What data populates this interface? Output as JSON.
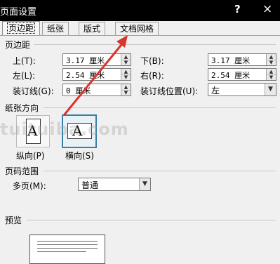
{
  "window": {
    "title": "页面设置",
    "help": "?",
    "close": "×"
  },
  "tabs": [
    {
      "label": "页边距",
      "active": true
    },
    {
      "label": "纸张",
      "active": false
    },
    {
      "label": "版式",
      "active": false
    },
    {
      "label": "文档网格",
      "active": false
    }
  ],
  "margins": {
    "section": "页边距",
    "top": {
      "label": "上(T):",
      "value": "3.17 厘米"
    },
    "bottom": {
      "label": "下(B):",
      "value": "3.17 厘米"
    },
    "left": {
      "label": "左(L):",
      "value": "2.54 厘米"
    },
    "right": {
      "label": "右(R):",
      "value": "2.54 厘米"
    },
    "gutter": {
      "label": "装订线(G):",
      "value": "0 厘米"
    },
    "gutter_position": {
      "label": "装订线位置(U):",
      "value": "左"
    }
  },
  "orientation": {
    "section": "纸张方向",
    "portrait": {
      "label": "纵向(P)",
      "glyph": "A"
    },
    "landscape": {
      "label": "横向(S)",
      "glyph": "A",
      "selected": true
    }
  },
  "pages": {
    "section": "页码范围",
    "multiple_label": "多页(M):",
    "multiple_value": "普通"
  },
  "preview": {
    "section": "预览"
  },
  "watermark": "tuituiba.com",
  "colors": {
    "annotation_arrow": "#d9332b",
    "selected_border": "#3a7fa6"
  },
  "icons": {
    "spin_up": "▲",
    "spin_down": "▼",
    "dropdown": "▼"
  }
}
